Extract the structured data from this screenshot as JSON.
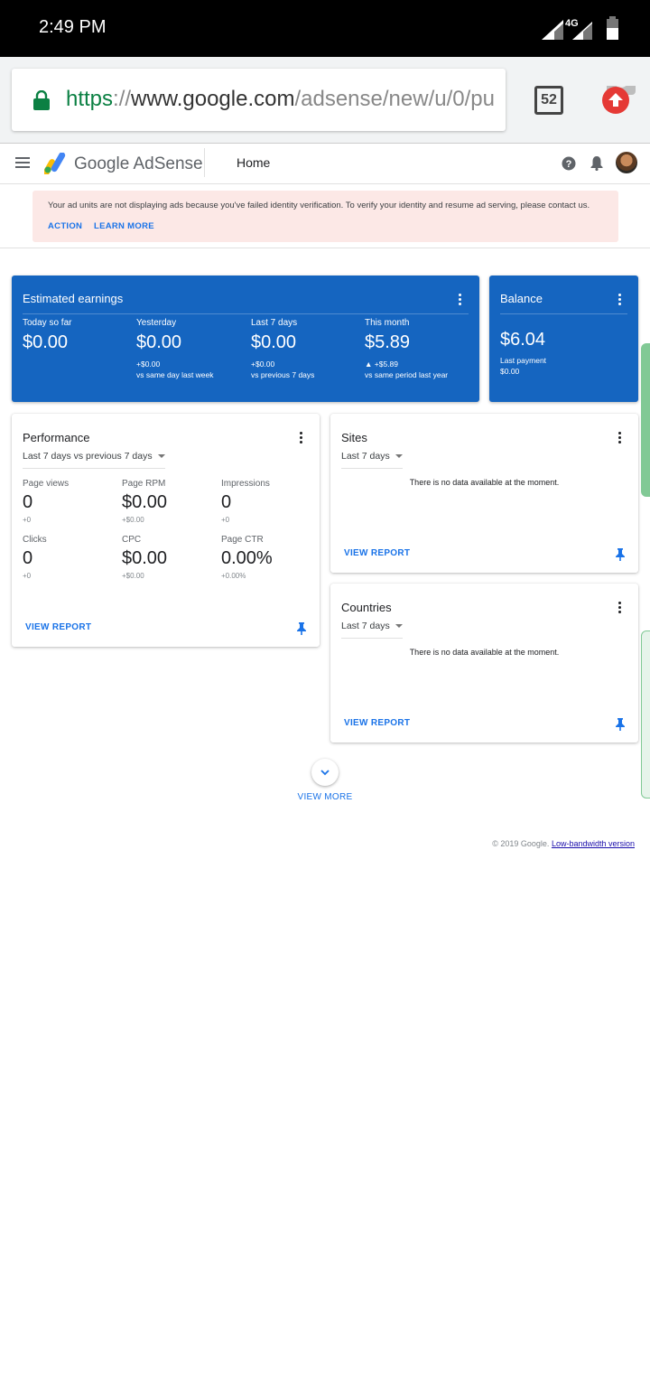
{
  "status_bar": {
    "time": "2:49 PM",
    "network": "4G"
  },
  "browser": {
    "url_scheme": "https",
    "url_sep": "://",
    "url_host": "www.google.com",
    "url_path": "/adsense/new/u/0/pu",
    "tab_count": "52"
  },
  "header": {
    "brand": "Google AdSense",
    "nav_home": "Home"
  },
  "alert": {
    "message": "Your ad units are not displaying ads because you've failed identity verification. To verify your identity and resume ad serving, please contact us.",
    "action": "ACTION",
    "learn_more": "LEARN MORE"
  },
  "earnings": {
    "title": "Estimated earnings",
    "columns": [
      {
        "label": "Today so far",
        "value": "$0.00",
        "delta": "",
        "note": ""
      },
      {
        "label": "Yesterday",
        "value": "$0.00",
        "delta": "+$0.00",
        "note": "vs same day last week"
      },
      {
        "label": "Last 7 days",
        "value": "$0.00",
        "delta": "+$0.00",
        "note": "vs previous 7 days"
      },
      {
        "label": "This month",
        "value": "$5.89",
        "delta": "▲ +$5.89",
        "note": "vs same period last year"
      }
    ]
  },
  "balance": {
    "title": "Balance",
    "value": "$6.04",
    "last_payment_label": "Last payment",
    "last_payment_value": "$0.00"
  },
  "performance": {
    "title": "Performance",
    "range": "Last 7 days vs previous 7 days",
    "metrics": [
      {
        "label": "Page views",
        "value": "0",
        "delta": "+0"
      },
      {
        "label": "Page RPM",
        "value": "$0.00",
        "delta": "+$0.00"
      },
      {
        "label": "Impressions",
        "value": "0",
        "delta": "+0"
      },
      {
        "label": "Clicks",
        "value": "0",
        "delta": "+0"
      },
      {
        "label": "CPC",
        "value": "$0.00",
        "delta": "+$0.00"
      },
      {
        "label": "Page CTR",
        "value": "0.00%",
        "delta": "+0.00%"
      }
    ],
    "view_report": "VIEW REPORT"
  },
  "sites": {
    "title": "Sites",
    "range": "Last 7 days",
    "empty": "There is no data available at the moment.",
    "view_report": "VIEW REPORT"
  },
  "countries": {
    "title": "Countries",
    "range": "Last 7 days",
    "empty": "There is no data available at the moment.",
    "view_report": "VIEW REPORT"
  },
  "view_more": "VIEW MORE",
  "footer": {
    "copyright": "© 2019 Google.",
    "low_bandwidth": "Low-bandwidth version"
  },
  "colors": {
    "brand_blue": "#1565c0",
    "link_blue": "#1a73e8",
    "alert_bg": "#fce8e6",
    "secure_green": "#0b8043"
  }
}
